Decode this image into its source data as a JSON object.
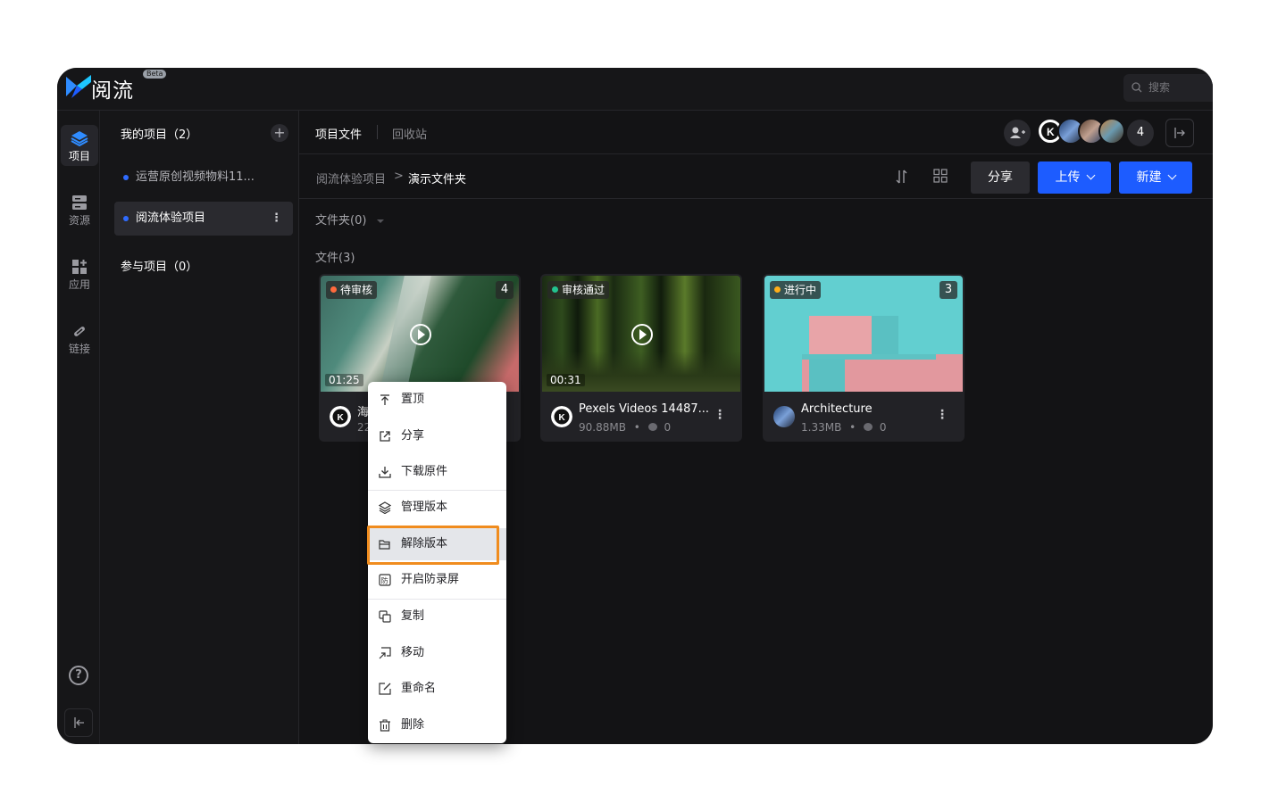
{
  "app": {
    "brand": "阅流",
    "badge": "Beta"
  },
  "search": {
    "placeholder": "搜索"
  },
  "nav": {
    "items": [
      {
        "label": "项目",
        "icon": "layers-icon"
      },
      {
        "label": "资源",
        "icon": "storage-icon"
      },
      {
        "label": "应用",
        "icon": "apps-icon"
      },
      {
        "label": "链接",
        "icon": "link-icon"
      }
    ],
    "help": "?"
  },
  "projects": {
    "my_title": "我的项目（2）",
    "add": "+",
    "items": [
      "运营原创视频物料11...",
      "阅流体验项目"
    ],
    "more": "⋮",
    "joined_title": "参与项目（0）"
  },
  "tabs": [
    "项目文件",
    "回收站"
  ],
  "members": {
    "count": "4"
  },
  "breadcrumb": {
    "root": "阅流体验项目",
    "sep": ">",
    "current": "演示文件夹"
  },
  "toolbar": {
    "share": "分享",
    "upload": "上传",
    "new": "新建"
  },
  "sections": {
    "folders": "文件夹(0)",
    "files": "文件(3)"
  },
  "files": [
    {
      "status": "待审核",
      "status_color": "#ff6a3d",
      "versions": "4",
      "duration": "01:25",
      "name": "海",
      "size": "22",
      "comments": "",
      "video": true
    },
    {
      "status": "审核通过",
      "status_color": "#23c28f",
      "versions": "",
      "duration": "00:31",
      "name": "Pexels Videos 14487...",
      "size": "90.88MB",
      "comments": "0",
      "video": true
    },
    {
      "status": "进行中",
      "status_color": "#ffae1a",
      "versions": "3",
      "duration": "",
      "name": "Architecture",
      "size": "1.33MB",
      "comments": "0",
      "video": false
    }
  ],
  "meta_sep": "•",
  "more_dots": "⋮",
  "context_menu": {
    "items": [
      "置顶",
      "分享",
      "下载原件",
      "管理版本",
      "解除版本",
      "开启防录屏",
      "复制",
      "移动",
      "重命名",
      "删除"
    ],
    "highlighted": "解除版本"
  },
  "colors": {
    "accent": "#1d5cff",
    "highlight_border": "#f08c1e"
  }
}
